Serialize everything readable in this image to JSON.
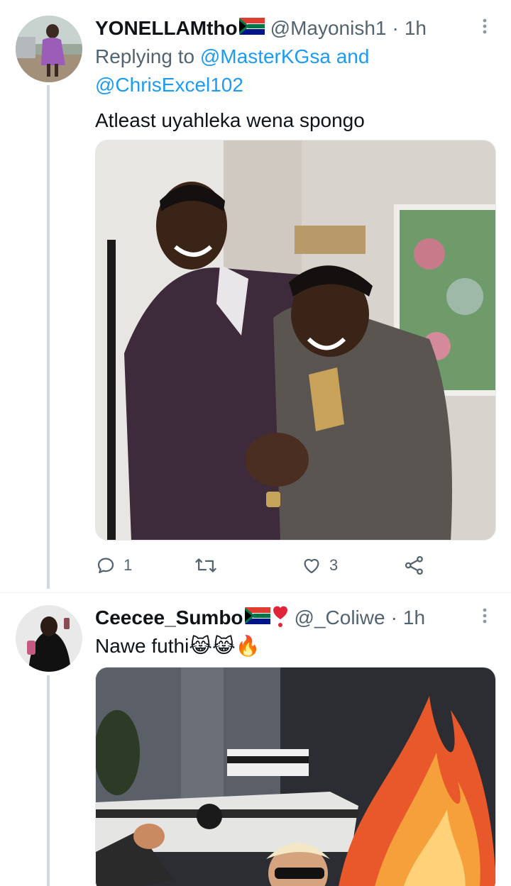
{
  "tweets": [
    {
      "display_name": "YONELLAMtho",
      "handle": "@Mayonish1",
      "time": "1h",
      "replying_to_label": "Replying to",
      "replying_to_user1": "@MasterKGsa",
      "replying_to_and": "and",
      "replying_to_user2": "@ChrisExcel102",
      "text": "Atleast uyahleka wena spongo",
      "actions": {
        "replies": "1",
        "retweets": "",
        "likes": "3"
      }
    },
    {
      "display_name": "Ceecee_Sumbo",
      "handle": "@_Coliwe",
      "time": "1h",
      "text": "Nawe futhi",
      "emoji": "😹😹🔥"
    }
  ],
  "meta_separator": "·",
  "colors": {
    "accent": "#1d9bf0",
    "secondary_text": "#536471",
    "thread_line": "#cfd9de"
  },
  "icons": [
    "reply-icon",
    "retweet-icon",
    "like-icon",
    "share-icon",
    "more-icon",
    "south-africa-flag-icon",
    "heart-emoji-icon"
  ]
}
